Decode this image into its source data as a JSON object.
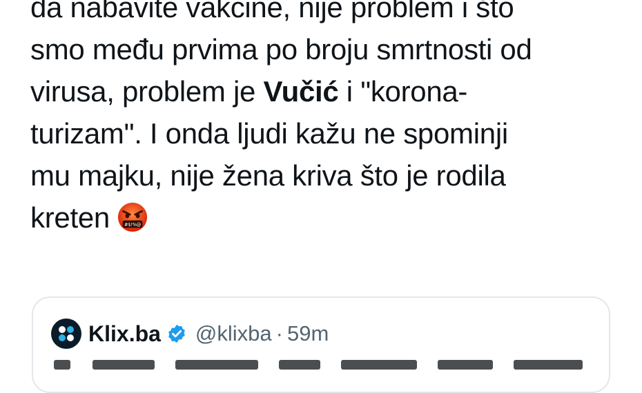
{
  "tweet": {
    "lines": [
      "da nabavite vakcine, nije problem i što",
      "smo među prvima po broju smrtnosti od",
      "virusa, problem je ",
      "turizam\". I onda ljudi kažu ne spominji",
      "mu majku, nije žena kriva što je rodila",
      "kreten"
    ],
    "bold_word": "Vučić",
    "line3_suffix": " i \"korona-",
    "emoji": "angry-face-with-symbols"
  },
  "quoted_tweet": {
    "author_name": "Klix.ba",
    "verified": true,
    "handle": "@klixba",
    "separator": "·",
    "time": "59m"
  },
  "colors": {
    "text": "#0f1419",
    "secondary": "#536471",
    "verified_blue": "#1d9bf0",
    "border": "#e3e6ea"
  }
}
